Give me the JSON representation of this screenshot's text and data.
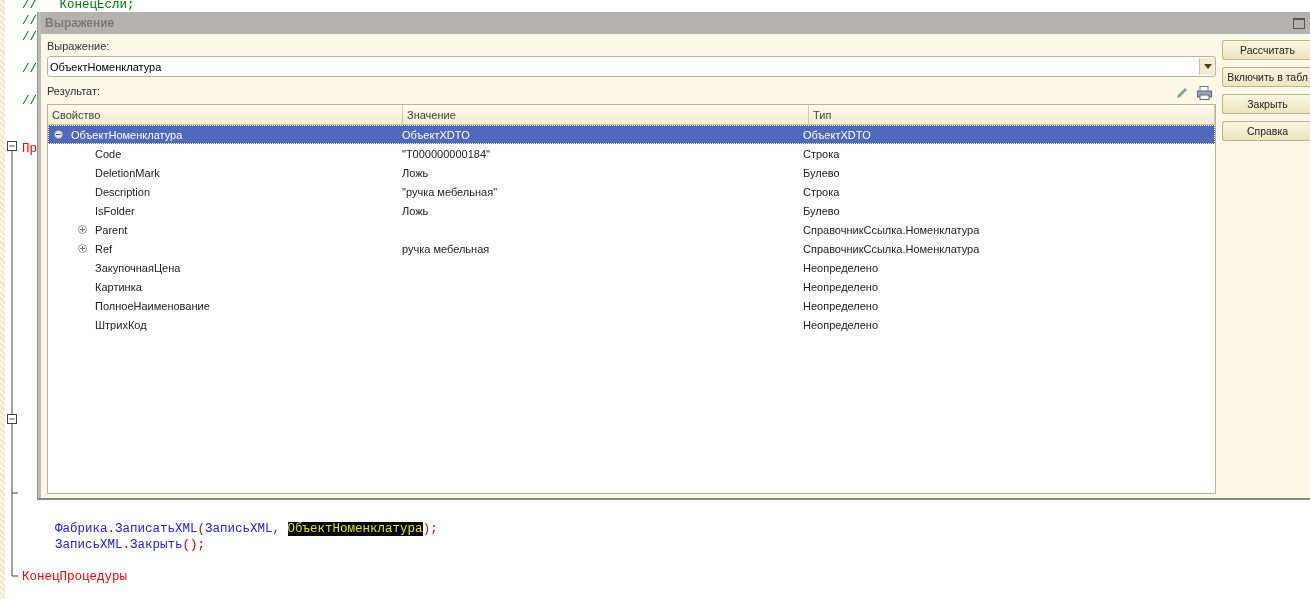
{
  "editor": {
    "top_lines": [
      {
        "kind": "comment",
        "text": "//   КонецЕсли;"
      },
      {
        "kind": "comment",
        "text": "//"
      },
      {
        "kind": "comment",
        "text": "//"
      },
      {
        "kind": "blank"
      },
      {
        "kind": "comment",
        "text": "//"
      },
      {
        "kind": "blank"
      },
      {
        "kind": "comment",
        "text": "//"
      },
      {
        "kind": "blank"
      },
      {
        "kind": "blank"
      },
      {
        "kind": "keyword",
        "text": "Пр"
      }
    ],
    "bottom_lines": [
      {
        "indent": true,
        "tokens": [
          {
            "kind": "ident",
            "text": "Фабрика"
          },
          {
            "kind": "punct",
            "text": "."
          },
          {
            "kind": "ident",
            "text": "ЗаписатьXML"
          },
          {
            "kind": "punct",
            "text": "("
          },
          {
            "kind": "ident",
            "text": "ЗаписьXML"
          },
          {
            "kind": "punct",
            "text": ", "
          },
          {
            "kind": "highlight",
            "text": "ОбъектНоменклатура"
          },
          {
            "kind": "punct",
            "text": ");"
          }
        ]
      },
      {
        "indent": true,
        "tokens": [
          {
            "kind": "ident",
            "text": "ЗаписьXML"
          },
          {
            "kind": "punct",
            "text": "."
          },
          {
            "kind": "ident",
            "text": "Закрыть"
          },
          {
            "kind": "punct",
            "text": "();"
          }
        ]
      },
      {
        "indent": false,
        "tokens": [
          {
            "kind": "keyword",
            "text": "КонецПроцедуры"
          }
        ]
      }
    ]
  },
  "dialog": {
    "title": "Выражение",
    "expression_label": "Выражение:",
    "expression": "ОбъектНоменклатура",
    "result_label": "Результат:",
    "table": {
      "columns": [
        "Свойство",
        "Значение",
        "Тип"
      ],
      "rows": [
        {
          "property": "ОбъектНоменклатура",
          "value": "ОбъектXDTO",
          "type": "ОбъектXDTO",
          "expanded": true,
          "selected": true,
          "children": [
            {
              "property": "Code",
              "value": "\"T000000000184\"",
              "type": "Строка",
              "expandable": false,
              "selected": false
            },
            {
              "property": "DeletionMark",
              "value": "Ложь",
              "type": "Булево",
              "expandable": false,
              "selected": false
            },
            {
              "property": "Description",
              "value": "\"ручка мебельная\"",
              "type": "Строка",
              "expandable": false,
              "selected": false
            },
            {
              "property": "IsFolder",
              "value": "Ложь",
              "type": "Булево",
              "expandable": false,
              "selected": false
            },
            {
              "property": "Parent",
              "type": "СправочникСсылка.Номенклатура",
              "expandable": true,
              "selected": false
            },
            {
              "property": "Ref",
              "value": "ручка мебельная",
              "type": "СправочникСсылка.Номенклатура",
              "expandable": true,
              "selected": false
            },
            {
              "property": "ЗакупочнаяЦена",
              "type": "Неопределено",
              "expandable": false,
              "selected": false
            },
            {
              "property": "Картинка",
              "type": "Неопределено",
              "expandable": false,
              "selected": false
            },
            {
              "property": "ПолноеНаименование",
              "type": "Неопределено",
              "expandable": false,
              "selected": false
            },
            {
              "property": "ШтрихКод",
              "type": "Неопределено",
              "expandable": false,
              "selected": false
            }
          ]
        }
      ]
    },
    "buttons": [
      "Рассчитать",
      "Включить в табл",
      "Закрыть",
      "Справка"
    ]
  }
}
